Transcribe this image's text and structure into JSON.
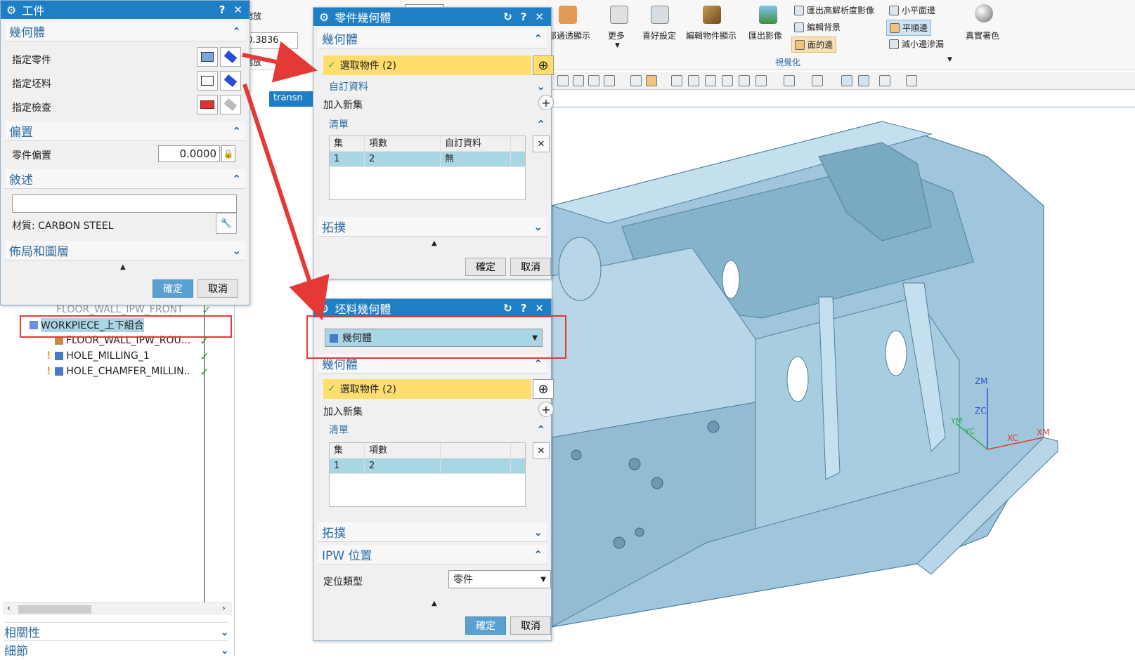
{
  "ribbon": {
    "zoom_label": "縮放",
    "zoom_value": "0.3836",
    "zoom2_label": "縮放",
    "items": [
      {
        "label": "部通透顯示"
      },
      {
        "label": "更多"
      },
      {
        "label": "喜好設定"
      },
      {
        "label": "編輯物件顯示"
      },
      {
        "label": "匯出影像"
      },
      {
        "label": "真實著色"
      }
    ],
    "small_items": [
      {
        "label": "匯出高解析度影像"
      },
      {
        "label": "編輯背景"
      },
      {
        "label": "面的邊"
      },
      {
        "label": "小平面邊"
      },
      {
        "label": "平順邊"
      },
      {
        "label": "減小邊滲漏"
      }
    ],
    "group_label": "視覺化",
    "tab_text": "transn"
  },
  "navigator": {
    "rows": [
      {
        "label": "FLOOR_WALL_IPW_FRONT"
      },
      {
        "label": "WORKPIECE_上下組合"
      },
      {
        "label": "FLOOR_WALL_IPW_ROU..."
      },
      {
        "label": "HOLE_MILLING_1"
      },
      {
        "label": "HOLE_CHAMFER_MILLIN..."
      }
    ],
    "sections": [
      {
        "label": "相關性"
      },
      {
        "label": "細節"
      }
    ]
  },
  "workpiece_dialog": {
    "title": "工件",
    "section_geometry": "幾何體",
    "specify_part": "指定零件",
    "specify_blank": "指定坯料",
    "specify_check": "指定檢查",
    "section_offset": "偏置",
    "part_offset_label": "零件偏置",
    "part_offset_value": "0.0000",
    "section_description": "敘述",
    "description_value": "",
    "material": "材質: CARBON STEEL",
    "section_layout": "佈局和圖層",
    "ok": "確定",
    "cancel": "取消"
  },
  "part_geometry_dialog": {
    "title": "零件幾何體",
    "section_geometry": "幾何體",
    "select_objects": "選取物件 (2)",
    "custom_data": "自訂資料",
    "add_new_set": "加入新集",
    "list_label": "清單",
    "columns": [
      "集",
      "項數",
      "自訂資料"
    ],
    "rows": [
      [
        "1",
        "2",
        "無"
      ]
    ],
    "section_topology": "拓撲",
    "ok": "確定",
    "cancel": "取消"
  },
  "blank_geometry_dialog": {
    "title": "坯料幾何體",
    "type_value": "幾何體",
    "section_geometry": "幾何體",
    "select_objects": "選取物件 (2)",
    "add_new_set": "加入新集",
    "list_label": "清單",
    "columns": [
      "集",
      "項數",
      ""
    ],
    "rows": [
      [
        "1",
        "2",
        ""
      ]
    ],
    "section_topology": "拓撲",
    "section_ipw": "IPW 位置",
    "position_type_label": "定位類型",
    "position_type_value": "零件",
    "ok": "確定",
    "cancel": "取消"
  },
  "axes": {
    "zm": "ZM",
    "zc": "ZC",
    "xc": "XC",
    "xm": "XM",
    "ym": "YM",
    "yc": "YC"
  },
  "colors": {
    "title_bar": "#1f7fc4",
    "highlight": "#ffde6e",
    "selection_row": "#a9d6e5",
    "model": "#9fc6dc",
    "arrow_red": "#e53935",
    "check_green": "#22b14c"
  }
}
